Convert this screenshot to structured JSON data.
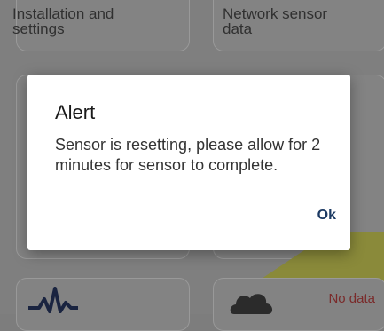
{
  "background": {
    "cards": [
      {
        "label_top": "Installation and",
        "label": "settings"
      },
      {
        "label_top": "Network sensor",
        "label": "data"
      }
    ],
    "status_text": "No data",
    "icons": [
      "pulse-icon",
      "cloud-icon"
    ]
  },
  "dialog": {
    "title": "Alert",
    "message": "Sensor is resetting, please allow for 2 minutes for sensor to complete.",
    "ok_label": "Ok"
  },
  "colors": {
    "overlay": "#7f7f7f",
    "dialog_bg": "#ffffff",
    "ok_button": "#1c3a63",
    "no_data": "#7a2a2a",
    "accent_band": "#8a8a3a"
  }
}
